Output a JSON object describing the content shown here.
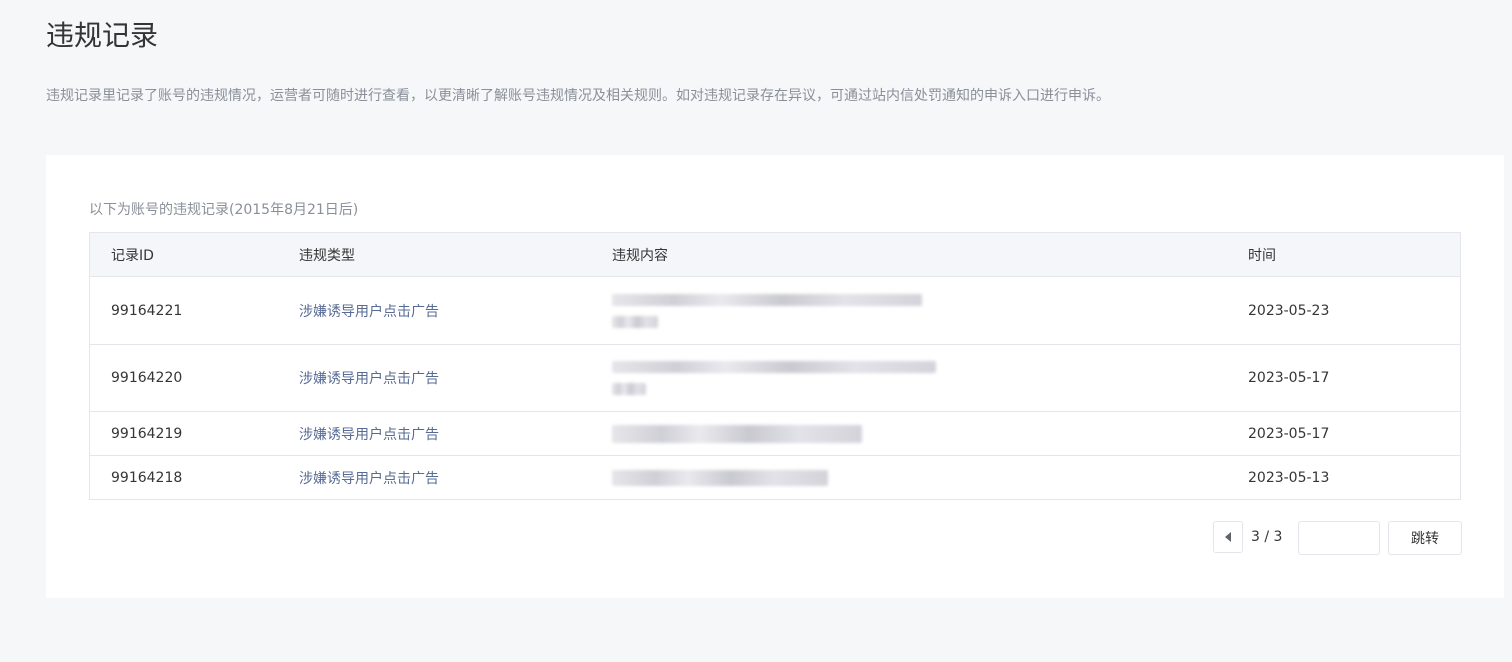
{
  "page": {
    "title": "违规记录",
    "description": "违规记录里记录了账号的违规情况，运营者可随时进行查看，以更清晰了解账号违规情况及相关规则。如对违规记录存在异议，可通过站内信处罚通知的申诉入口进行申诉。"
  },
  "records": {
    "subtitle": "以下为账号的违规记录(2015年8月21日后)",
    "columns": {
      "id": "记录ID",
      "type": "违规类型",
      "content": "违规内容",
      "time": "时间"
    },
    "rows": [
      {
        "id": "99164221",
        "type": "涉嫌诱导用户点击广告",
        "time": "2023-05-23"
      },
      {
        "id": "99164220",
        "type": "涉嫌诱导用户点击广告",
        "time": "2023-05-17"
      },
      {
        "id": "99164219",
        "type": "涉嫌诱导用户点击广告",
        "time": "2023-05-17"
      },
      {
        "id": "99164218",
        "type": "涉嫌诱导用户点击广告",
        "time": "2023-05-13"
      }
    ]
  },
  "pagination": {
    "indicator": "3 / 3",
    "input_value": "",
    "jump_label": "跳转",
    "prev_icon": "caret-left-icon"
  },
  "colors": {
    "background": "#f6f7f9",
    "link": "#576b95",
    "muted_text": "#8a8f99",
    "border": "#e4e6eb"
  }
}
